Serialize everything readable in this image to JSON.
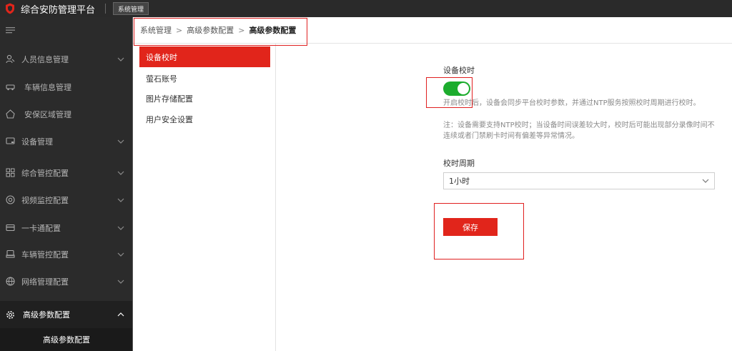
{
  "header": {
    "app_title": "综合安防管理平台",
    "system_tab": "系统管理",
    "logo_icon": "shield-logo-icon"
  },
  "sidebar": {
    "collapse_icon": "menu-collapse-icon",
    "items": [
      {
        "label": "人员信息管理",
        "icon": "person-icon",
        "has_chevron": true
      },
      {
        "label": "车辆信息管理",
        "icon": "car-icon",
        "has_chevron": false
      },
      {
        "label": "安保区域管理",
        "icon": "area-icon",
        "has_chevron": false
      },
      {
        "label": "设备管理",
        "icon": "device-icon",
        "has_chevron": true
      },
      {
        "label": "综合管控配置",
        "icon": "grid-icon",
        "has_chevron": true
      },
      {
        "label": "视频监控配置",
        "icon": "camera-icon",
        "has_chevron": true
      },
      {
        "label": "一卡通配置",
        "icon": "card-icon",
        "has_chevron": true
      },
      {
        "label": "车辆管控配置",
        "icon": "vehicle-control-icon",
        "has_chevron": true
      },
      {
        "label": "网络管理配置",
        "icon": "network-icon",
        "has_chevron": true
      },
      {
        "label": "高级参数配置",
        "icon": "gear-icon",
        "has_chevron": true,
        "expanded": true
      }
    ],
    "sub_item": "高级参数配置"
  },
  "breadcrumb": {
    "items": [
      "系统管理",
      "高级参数配置"
    ],
    "current": "高级参数配置",
    "separator": ">"
  },
  "subnav": {
    "items": [
      "设备校时",
      "萤石账号",
      "图片存储配置",
      "用户安全设置"
    ],
    "active_index": 0
  },
  "form": {
    "section_label": "设备校时",
    "toggle_on": true,
    "description": "开启校时后，设备会同步平台校时参数，并通过NTP服务按照校时周期进行校时。",
    "note": "注：设备需要支持NTP校时；当设备时间误差较大时，校时后可能出现部分录像时间不连续或者门禁刷卡时间有偏差等异常情况。",
    "period_label": "校时周期",
    "period_value": "1小时",
    "save_label": "保存"
  },
  "colors": {
    "accent_red": "#e1251b",
    "toggle_green": "#1cac2d",
    "sidebar_bg": "#2b2b2b",
    "topbar_bg": "#2a2a2a",
    "highlight_box": "#e02020"
  }
}
